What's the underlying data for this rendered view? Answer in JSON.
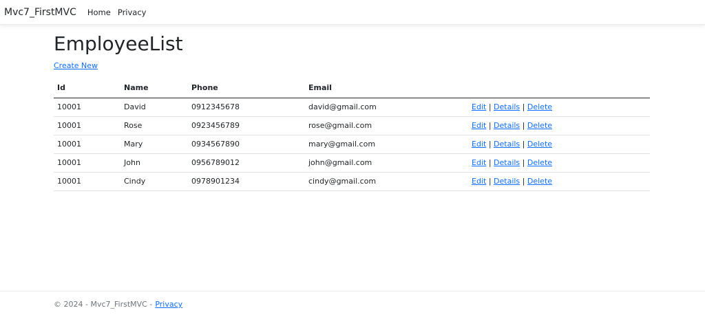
{
  "navbar": {
    "brand": "Mvc7_FirstMVC",
    "links": [
      "Home",
      "Privacy"
    ]
  },
  "page": {
    "title": "EmployeeList",
    "create_link": "Create New"
  },
  "table": {
    "headers": [
      "Id",
      "Name",
      "Phone",
      "Email"
    ],
    "rows": [
      {
        "id": "10001",
        "name": "David",
        "phone": "0912345678",
        "email": "david@gmail.com"
      },
      {
        "id": "10001",
        "name": "Rose",
        "phone": "0923456789",
        "email": "rose@gmail.com"
      },
      {
        "id": "10001",
        "name": "Mary",
        "phone": "0934567890",
        "email": "mary@gmail.com"
      },
      {
        "id": "10001",
        "name": "John",
        "phone": "0956789012",
        "email": "john@gmail.com"
      },
      {
        "id": "10001",
        "name": "Cindy",
        "phone": "0978901234",
        "email": "cindy@gmail.com"
      }
    ],
    "actions": {
      "edit": "Edit",
      "details": "Details",
      "delete": "Delete",
      "separator": "|"
    }
  },
  "footer": {
    "text": "© 2024 - Mvc7_FirstMVC -",
    "link": "Privacy"
  },
  "colors": {
    "link": "#0d6efd",
    "text": "#212529",
    "muted": "#6c757d"
  }
}
